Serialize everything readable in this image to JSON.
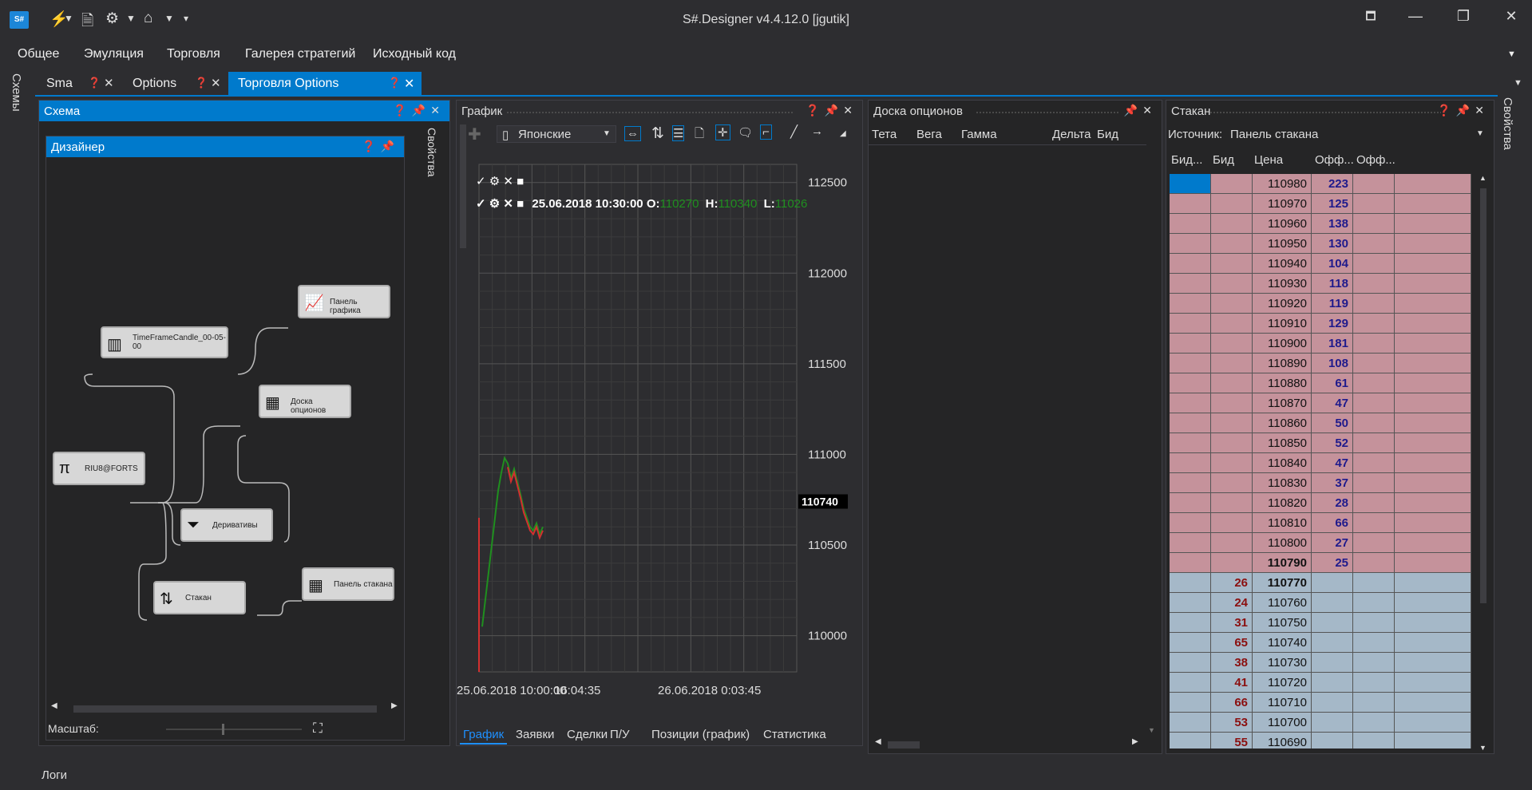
{
  "app": {
    "title": "S#.Designer v4.4.12.0 [jgutik]",
    "logo": "S#"
  },
  "toolbar": {
    "icons": [
      "plug-icon",
      "chevron-down-icon",
      "file-icon",
      "gear-icon",
      "chevron-down-icon",
      "home-gear-icon",
      "chevron-down-icon",
      "overflow-icon"
    ]
  },
  "window": {
    "restore": "🗖",
    "minimize": "—",
    "maximize": "❐",
    "close": "✕"
  },
  "menu": [
    "Общее",
    "Эмуляция",
    "Торговля",
    "Галерея стратегий",
    "Исходный код"
  ],
  "sidebars": {
    "left": "Схемы",
    "right": "Свойства",
    "inner": "Свойства"
  },
  "tabs": [
    {
      "label": "Sma",
      "active": false
    },
    {
      "label": "Options",
      "active": false
    },
    {
      "label": "Торговля Options",
      "active": true
    }
  ],
  "schema": {
    "title": "Схема",
    "designer_title": "Дизайнер",
    "scale_label": "Масштаб:",
    "nodes": [
      {
        "label": "Панель графика",
        "icon": "chart-icon"
      },
      {
        "label": "TimeFrameCandle_00-05-00",
        "icon": "candles-icon"
      },
      {
        "label": "Доска опционов",
        "icon": "table-icon"
      },
      {
        "label": "RIU8@FORTS",
        "icon": "pi-icon"
      },
      {
        "label": "Деривативы",
        "icon": "filter-icon"
      },
      {
        "label": "Стакан",
        "icon": "updown-icon"
      },
      {
        "label": "Панель стакана",
        "icon": "table-icon"
      }
    ]
  },
  "chart": {
    "title": "График",
    "style_select": "Японские",
    "legend": "25.06.2018 10:30:00 O:110270 H:110340 L:11026",
    "legend_date": "25.06.2018 10:30:00",
    "o_label": "O:",
    "o_value": "110270",
    "h_label": "H:",
    "h_value": "110340",
    "l_label": "L:",
    "l_value": "11026",
    "current_price": "110740",
    "bottom_tabs": [
      "График",
      "Заявки",
      "Сделки",
      "П/У",
      "Позиции (график)",
      "Статистика"
    ]
  },
  "chart_data": {
    "type": "line",
    "title": "",
    "xlabel": "",
    "ylabel": "",
    "y_ticks": [
      110000,
      110500,
      111000,
      111500,
      112000,
      112500
    ],
    "x_ticks": [
      "25.06.2018 10:00:00",
      "16:04:35",
      "26.06.2018 0:03:45"
    ],
    "ylim": [
      109800,
      112600
    ],
    "last_price": 110740
  },
  "options_board": {
    "title": "Доска опционов",
    "columns": [
      "Тета",
      "Вега",
      "Гамма",
      "Дельта",
      "Бид"
    ]
  },
  "orderbook": {
    "title": "Стакан",
    "source_label": "Источник:",
    "source_value": "Панель стакана",
    "columns": [
      "Бид...",
      "Бид",
      "Цена",
      "Офф...",
      "Офф..."
    ],
    "asks": [
      [
        "110980",
        "223"
      ],
      [
        "110970",
        "125"
      ],
      [
        "110960",
        "138"
      ],
      [
        "110950",
        "130"
      ],
      [
        "110940",
        "104"
      ],
      [
        "110930",
        "118"
      ],
      [
        "110920",
        "119"
      ],
      [
        "110910",
        "129"
      ],
      [
        "110900",
        "181"
      ],
      [
        "110890",
        "108"
      ],
      [
        "110880",
        "61"
      ],
      [
        "110870",
        "47"
      ],
      [
        "110860",
        "50"
      ],
      [
        "110850",
        "52"
      ],
      [
        "110840",
        "47"
      ],
      [
        "110830",
        "37"
      ],
      [
        "110820",
        "28"
      ],
      [
        "110810",
        "66"
      ],
      [
        "110800",
        "27"
      ],
      [
        "110790",
        "25"
      ]
    ],
    "bids": [
      [
        "26",
        "110770"
      ],
      [
        "24",
        "110760"
      ],
      [
        "31",
        "110750"
      ],
      [
        "65",
        "110740"
      ],
      [
        "38",
        "110730"
      ],
      [
        "41",
        "110720"
      ],
      [
        "66",
        "110710"
      ],
      [
        "53",
        "110700"
      ],
      [
        "55",
        "110690"
      ]
    ],
    "colors": {
      "ask_row": "#c5929b",
      "bid_row": "#a5b8c8",
      "ask_qty": "#1f1a8c",
      "bid_qty": "#8b0f0f"
    }
  },
  "logs": {
    "label": "Логи"
  }
}
